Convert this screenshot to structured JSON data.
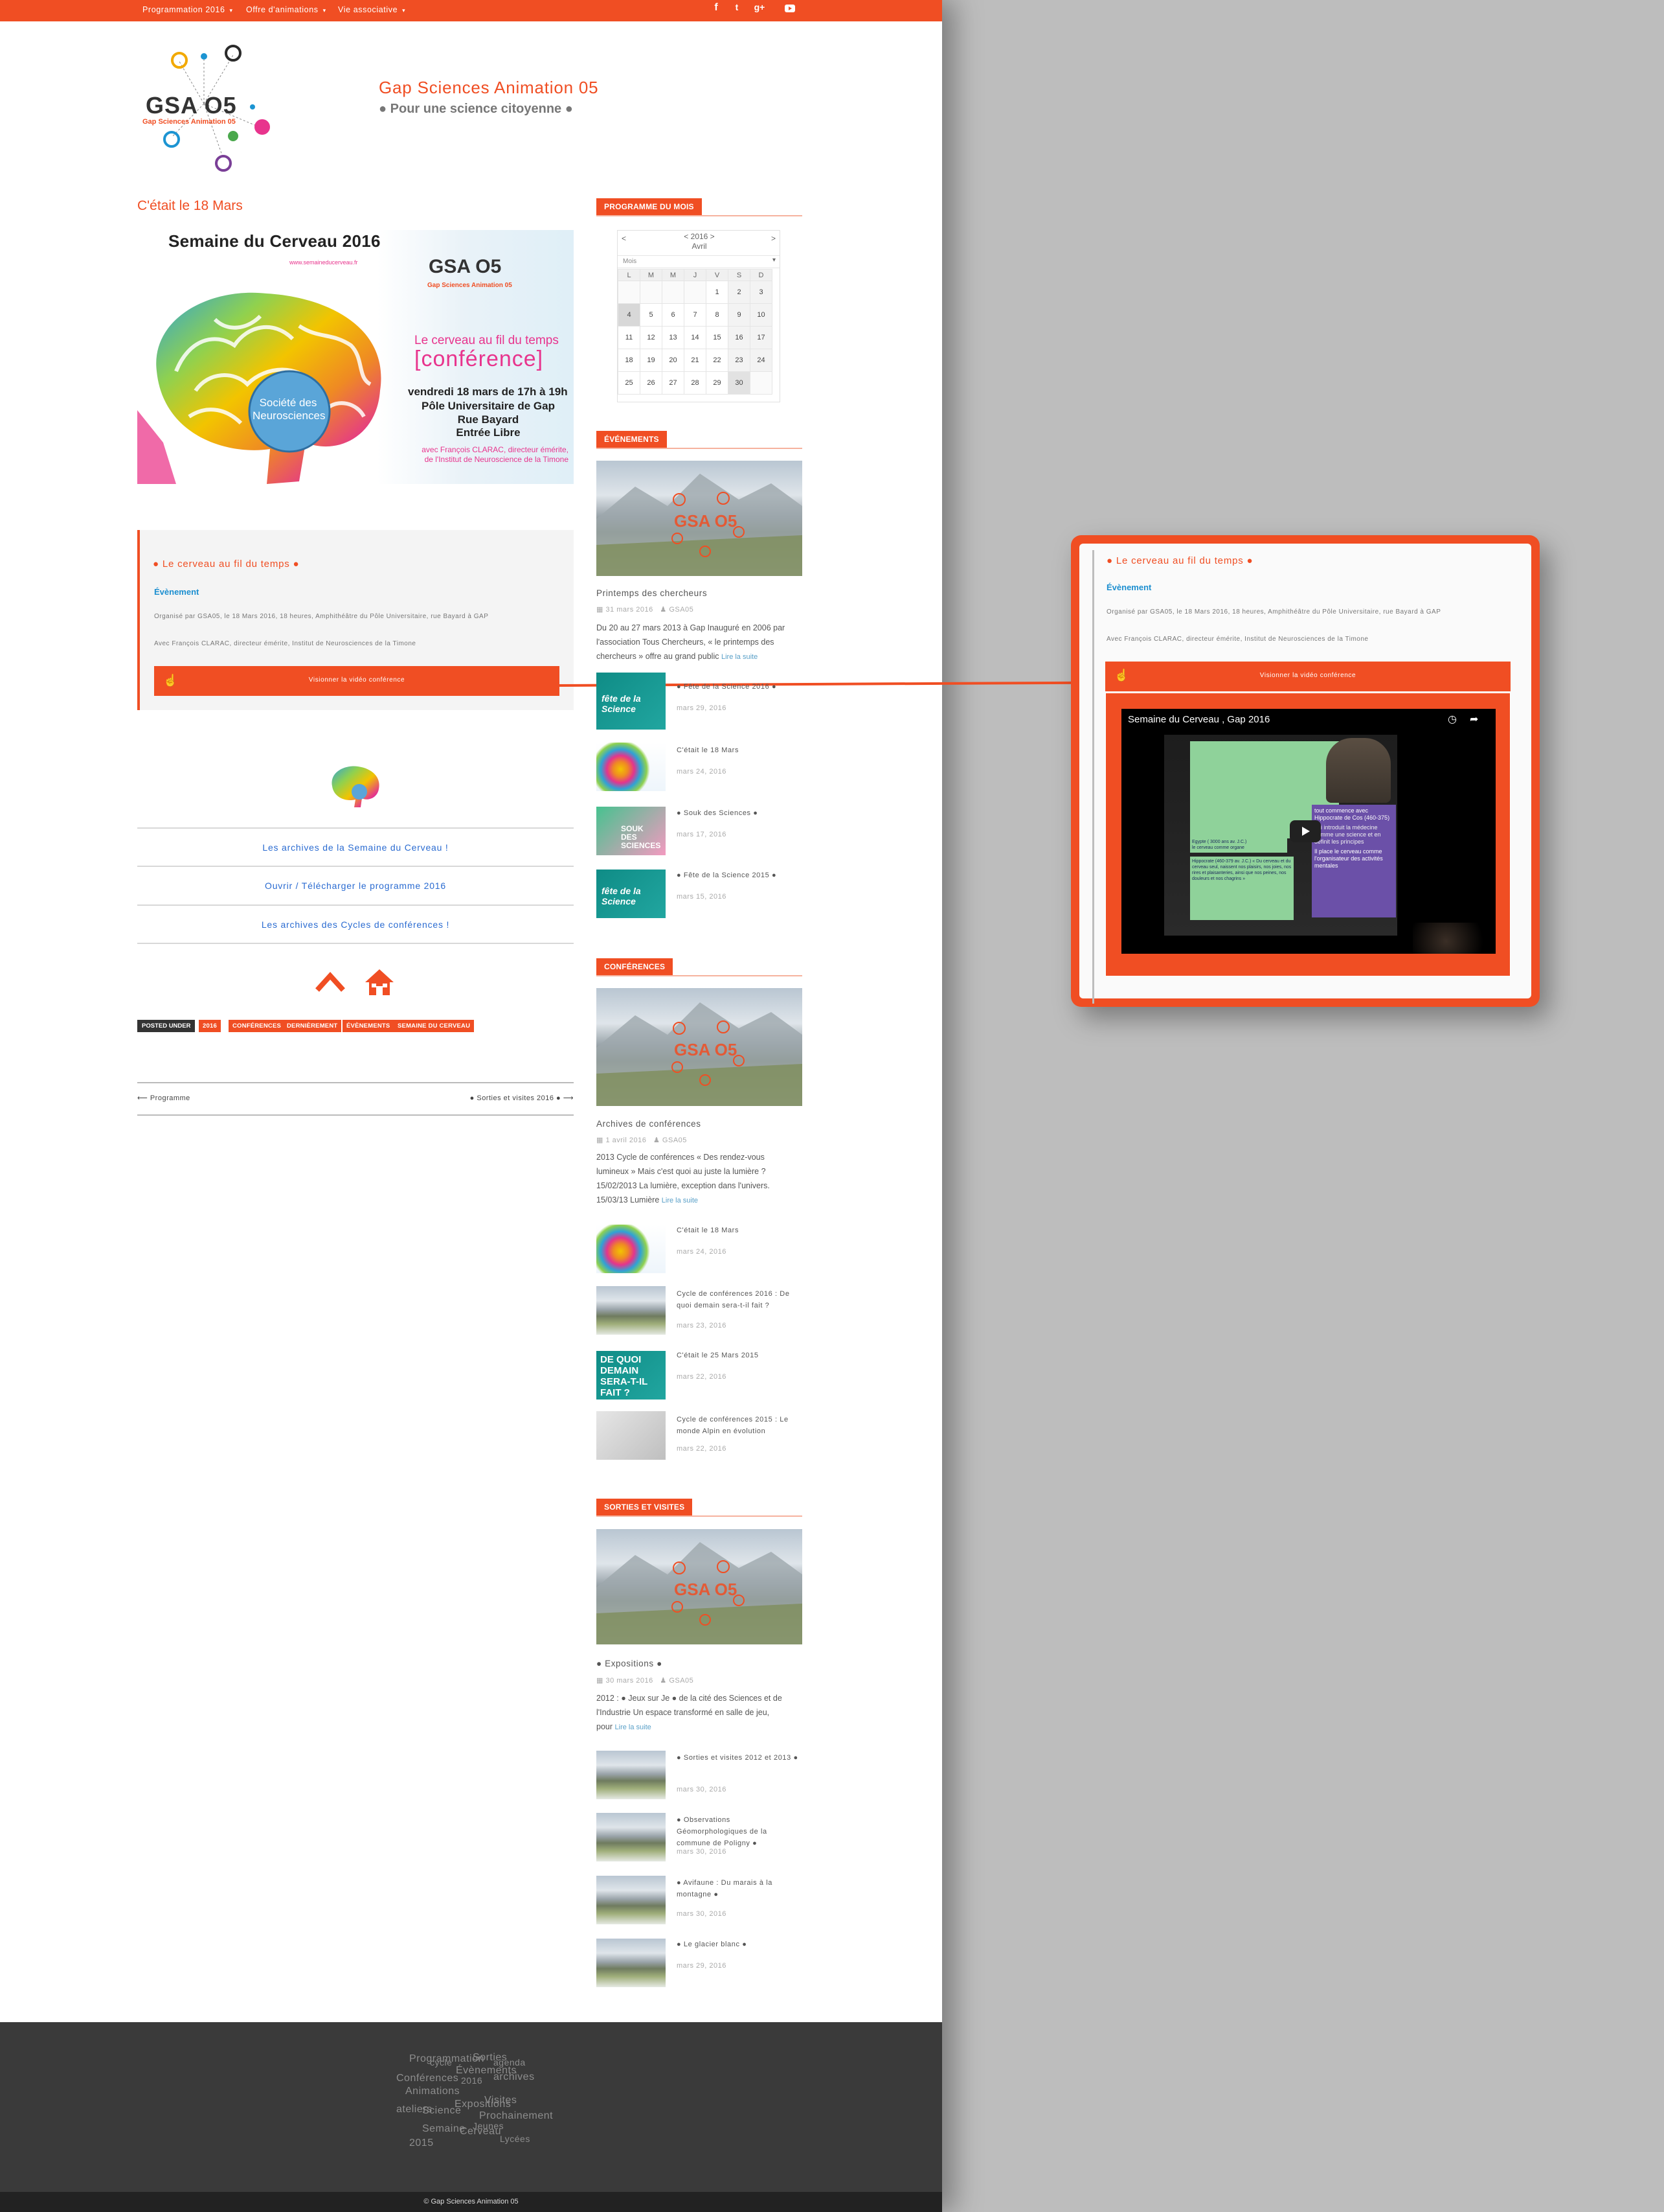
{
  "topbar": {
    "menu": [
      "Programmation 2016",
      "Offre d'animations",
      "Vie associative"
    ],
    "social_icons": [
      "facebook-icon",
      "twitter-icon",
      "googleplus-icon",
      "youtube-icon"
    ]
  },
  "header": {
    "logo_text": "GSA O5",
    "logo_sub": "Gap Sciences Animation 05",
    "site_title": "Gap Sciences Animation 05",
    "tagline": "● Pour une science citoyenne ●"
  },
  "article": {
    "title": "C'était le 18 Mars",
    "poster": {
      "heading": "Semaine du Cerveau 2016",
      "url": "www.semaineducerveau.fr",
      "logo_text": "GSA O5",
      "logo_sub": "Gap Sciences Animation 05",
      "conf_line1": "Le cerveau au fil du temps",
      "conf_line2": "[conférence]",
      "date_line": "vendredi 18 mars de 17h à 19h",
      "place1": "Pôle Universitaire de Gap",
      "place2": "Rue Bayard",
      "place3": "Entrée Libre",
      "speaker1": "avec François CLARAC, directeur émérite,",
      "speaker2": "de l'Institut de Neuroscience de la Timone",
      "society": "Société des Neurosciences"
    },
    "box": {
      "title": "● Le cerveau au fil du temps ●",
      "category": "Évènement",
      "line1": "Organisé par GSA05, le 18 Mars 2016, 18 heures, Amphithéâtre du Pôle Universitaire, rue Bayard à GAP",
      "line2": "Avec François CLARAC, directeur émérite, Institut de Neurosciences de la Timone",
      "button": "Visionner la vidéo conférence"
    },
    "links": [
      {
        "text": "Les archives de la Semaine du Cerveau !"
      },
      {
        "text": "Ouvrir / Télécharger le programme 2016"
      },
      {
        "text": "Les archives des Cycles de conférences !"
      }
    ],
    "posted_under": "POSTED UNDER",
    "tags": [
      "2016",
      "CONFÉRENCES",
      "DERNIÈREMENT",
      "ÉVÈNEMENTS",
      "SEMAINE DU CERVEAU"
    ],
    "prev": "Programme",
    "next": "● Sorties et visites 2016 ●"
  },
  "sidebar": {
    "programme": {
      "heading": "PROGRAMME DU MOIS",
      "year": "< 2016 >",
      "month": "Avril",
      "prev": "<",
      "next": ">",
      "view": "Mois",
      "days": [
        "L",
        "M",
        "M",
        "J",
        "V",
        "S",
        "D"
      ],
      "weeks": [
        [
          "",
          "",
          "",
          "",
          "1",
          "2",
          "3"
        ],
        [
          "4",
          "5",
          "6",
          "7",
          "8",
          "9",
          "10"
        ],
        [
          "11",
          "12",
          "13",
          "14",
          "15",
          "16",
          "17"
        ],
        [
          "18",
          "19",
          "20",
          "21",
          "22",
          "23",
          "24"
        ],
        [
          "25",
          "26",
          "27",
          "28",
          "29",
          "30",
          ""
        ]
      ]
    },
    "events": {
      "heading": "ÉVÉNEMENTS",
      "featured": {
        "title": "Printemps des chercheurs",
        "date": "31 mars 2016",
        "author": "GSA05",
        "excerpt1": "Du 20 au 27 mars 2013 à Gap Inauguré en 2006 par",
        "excerpt2": "l'association Tous Chercheurs, « le printemps des",
        "excerpt3": "chercheurs » offre au grand public",
        "more": "Lire la suite"
      },
      "items": [
        {
          "title": "● Fête de la Science 2016 ●",
          "date": "mars 29, 2016"
        },
        {
          "title": "C'était le 18 Mars",
          "date": "mars 24, 2016"
        },
        {
          "title": "● Souk des Sciences ●",
          "date": "mars 17, 2016"
        },
        {
          "title": "● Fête de la Science 2015 ●",
          "date": "mars 15, 2016"
        }
      ],
      "thumb_labels": [
        "fête de la Science",
        "SOUK DES SCIENCES",
        "fête de la Science"
      ]
    },
    "conferences": {
      "heading": "CONFÉRENCES",
      "featured": {
        "title": "Archives de conférences",
        "date": "1 avril 2016",
        "author": "GSA05",
        "excerpt1": "2013 Cycle de conférences « Des rendez-vous",
        "excerpt2": "lumineux » Mais c'est quoi au juste la lumière ?",
        "excerpt3": "15/02/2013 La lumière, exception dans l'univers.",
        "excerpt4": "15/03/13 Lumière",
        "more": "Lire la suite"
      },
      "items": [
        {
          "title": "C'était le 18 Mars",
          "date": "mars 24, 2016"
        },
        {
          "title": "Cycle de conférences 2016 : De quoi demain sera-t-il fait ?",
          "date": "mars 23, 2016"
        },
        {
          "title": "C'était le 25 Mars 2015",
          "date": "mars 22, 2016"
        },
        {
          "title": "Cycle de conférences 2015 : Le monde Alpin en évolution",
          "date": "mars 22, 2016"
        }
      ],
      "thumb_labels": [
        "DE QUOI DEMAIN SERA-T-IL FAIT ?"
      ]
    },
    "sorties": {
      "heading": "SORTIES ET VISITES",
      "featured": {
        "title": "● Expositions ●",
        "date": "30 mars 2016",
        "author": "GSA05",
        "excerpt1": "2012 : ● Jeux sur Je ● de la cité des Sciences et de",
        "excerpt2": "l'Industrie Un espace transformé en salle de jeu,",
        "excerpt3": "pour",
        "more": "Lire la suite"
      },
      "items": [
        {
          "title": "● Sorties et visites 2012 et 2013 ●",
          "date": "mars 30, 2016"
        },
        {
          "title": "● Observations Géomorphologiques de la commune de Poligny ●",
          "date": "mars 30, 2016"
        },
        {
          "title": "● Avifaune : Du marais à la montagne ●",
          "date": "mars 30, 2016"
        },
        {
          "title": "● Le glacier blanc ●",
          "date": "mars 29, 2016"
        }
      ]
    }
  },
  "popup": {
    "title": "● Le cerveau au fil du temps ●",
    "category": "Évènement",
    "line1": "Organisé par GSA05, le 18 Mars 2016, 18 heures, Amphithéâtre du Pôle Universitaire, rue Bayard à GAP",
    "line2": "Avec François CLARAC, directeur émérite, Institut de Neurosciences de la Timone",
    "button": "Visionner la vidéo conférence",
    "video": {
      "title": "Semaine du Cerveau , Gap 2016",
      "slide1": "tout commence avec Hippocrate de Cos (460-375)",
      "slide2": "qui introduit la médecine comme une science et en définit les principes",
      "slide3": "Il place le cerveau comme l'organisateur des activités mentales",
      "slide4": "Egypte ( 3000 ans av. J.C.)",
      "slide5": "le cerveau comme organe",
      "slide6": "Hippocrate (460-379 av. J.C.) « Du cerveau et du cerveau seul, naissent nos plaisirs, nos joies, nos rires et plaisanteries, ainsi que nos peines, nos douleurs et nos chagrins »"
    }
  },
  "footer": {
    "words": [
      "Programmation",
      "cycle",
      "Sorties",
      "Évènements",
      "agenda",
      "Conférences",
      "2016",
      "Expositions",
      "Animations",
      "archives",
      "Visites",
      "ateliers",
      "Prochainement",
      "Semaine",
      "Cerveau",
      "Science",
      "Jeunes",
      "Lycées",
      "2015"
    ],
    "copyright": "© Gap Sciences Animation 05"
  },
  "colors": {
    "accent": "#f04e23",
    "link": "#2a6bd1",
    "footer_bg": "#3a3a3a",
    "outer_bg": "#bdbdbd"
  }
}
